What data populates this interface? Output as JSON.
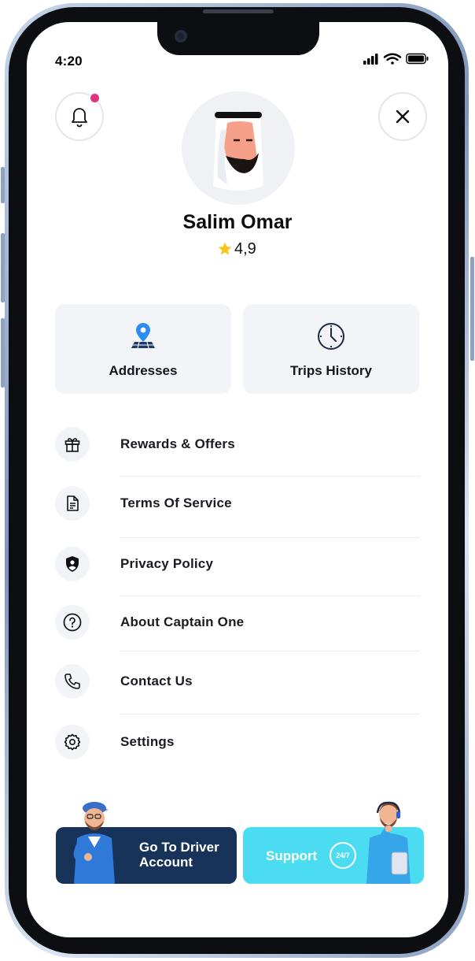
{
  "status_bar": {
    "time": "4:20"
  },
  "profile": {
    "name": "Salim Omar",
    "rating": "4,9"
  },
  "cards": [
    {
      "label": "Addresses",
      "icon": "location-pin-icon"
    },
    {
      "label": "Trips History",
      "icon": "clock-icon"
    }
  ],
  "menu": [
    {
      "label": "Rewards & Offers",
      "icon": "gift-icon"
    },
    {
      "label": "Terms Of Service",
      "icon": "document-icon"
    },
    {
      "label": "Privacy Policy",
      "icon": "shield-user-icon"
    },
    {
      "label": "About Captain One",
      "icon": "question-circle-icon"
    },
    {
      "label": "Contact Us",
      "icon": "phone-icon"
    },
    {
      "label": "Settings",
      "icon": "gear-icon"
    }
  ],
  "bottom": {
    "driver_label": "Go To Driver Account",
    "support_label": "Support",
    "support_badge": "24/7"
  },
  "colors": {
    "accent_dark": "#17335a",
    "accent_cyan": "#4cdcf1",
    "notification_dot": "#e0337a",
    "card_bg": "#f3f4f7"
  }
}
